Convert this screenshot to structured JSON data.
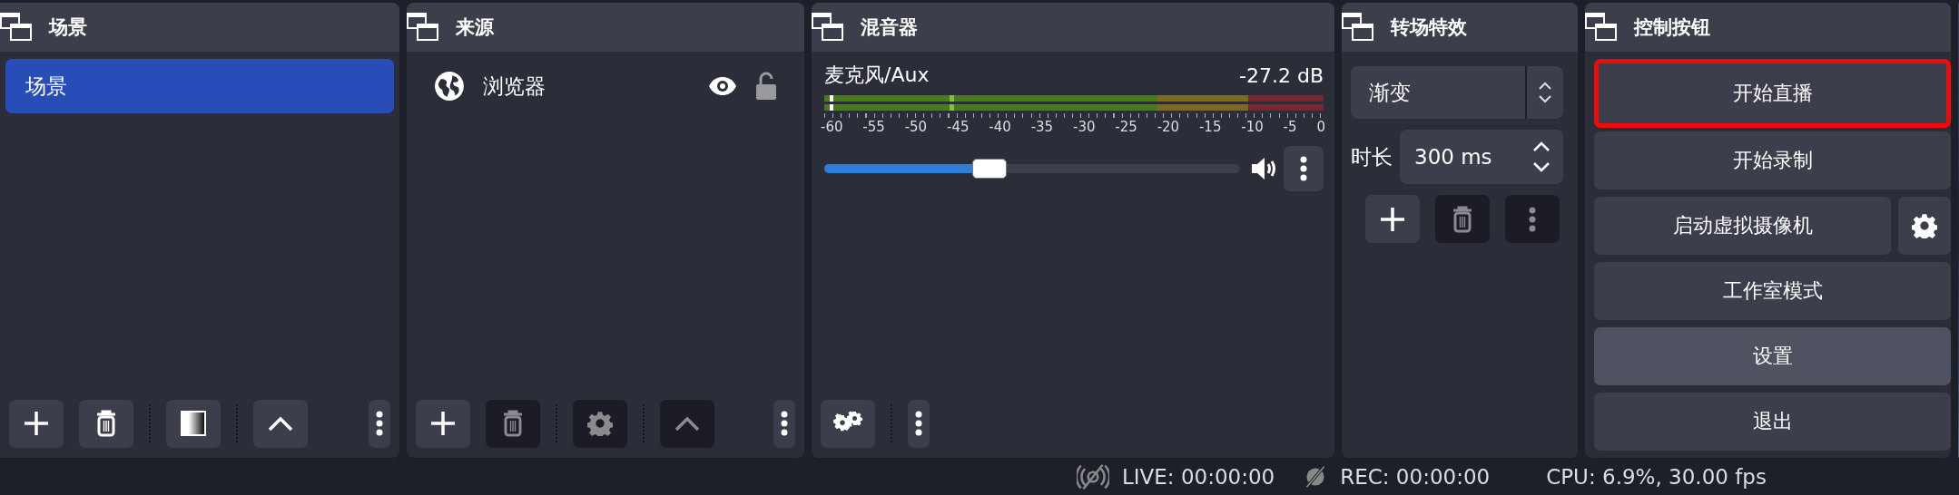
{
  "scenes": {
    "title": "场景",
    "items": [
      {
        "label": "场景",
        "selected": true
      }
    ],
    "toolbar": [
      {
        "kind": "add",
        "disabled": false
      },
      {
        "kind": "remove",
        "disabled": false
      },
      {
        "kind": "separator"
      },
      {
        "kind": "filters",
        "disabled": false
      },
      {
        "kind": "separator"
      },
      {
        "kind": "up",
        "disabled": false
      },
      {
        "kind": "spacer"
      },
      {
        "kind": "menu",
        "disabled": false
      }
    ]
  },
  "sources": {
    "title": "来源",
    "items": [
      {
        "label": "浏览器",
        "selected": false,
        "visible": true,
        "locked": false
      }
    ],
    "toolbar": [
      {
        "kind": "add",
        "disabled": false
      },
      {
        "kind": "remove",
        "disabled": true
      },
      {
        "kind": "separator"
      },
      {
        "kind": "properties",
        "disabled": true
      },
      {
        "kind": "separator"
      },
      {
        "kind": "up",
        "disabled": true
      },
      {
        "kind": "spacer"
      },
      {
        "kind": "menu",
        "disabled": false
      }
    ]
  },
  "mixer": {
    "title": "混音器",
    "channels": [
      {
        "name": "麦克风/Aux",
        "reading": "-27.2 dB",
        "level": 0.4,
        "muted": false,
        "ticks": [
          "-60",
          "-55",
          "-50",
          "-45",
          "-40",
          "-35",
          "-30",
          "-25",
          "-20",
          "-15",
          "-10",
          "-5",
          "0"
        ]
      }
    ],
    "toolbar": [
      {
        "kind": "advanced",
        "disabled": false
      },
      {
        "kind": "separator"
      },
      {
        "kind": "menu",
        "disabled": false
      }
    ]
  },
  "transitions": {
    "title": "转场特效",
    "transition": "渐变",
    "duration_label": "时长",
    "duration": "300 ms",
    "toolbar": [
      {
        "kind": "add",
        "disabled": false
      },
      {
        "kind": "remove",
        "disabled": true
      },
      {
        "kind": "menu",
        "disabled": true
      }
    ]
  },
  "controls": {
    "title": "控制按钮",
    "buttons": [
      {
        "label": "开始直播",
        "kind": "plain",
        "highlighted": true,
        "hovered": false
      },
      {
        "label": "开始录制",
        "kind": "plain",
        "highlighted": false,
        "hovered": false
      },
      {
        "label": "启动虚拟摄像机",
        "kind": "with-settings",
        "highlighted": false,
        "hovered": false
      },
      {
        "label": "工作室模式",
        "kind": "plain",
        "highlighted": false,
        "hovered": false
      },
      {
        "label": "设置",
        "kind": "plain",
        "highlighted": false,
        "hovered": true
      },
      {
        "label": "退出",
        "kind": "plain",
        "highlighted": false,
        "hovered": false
      }
    ]
  },
  "status_bar": {
    "live": "LIVE: 00:00:00",
    "rec": "REC: 00:00:00",
    "cpu": "CPU: 6.9%, 30.00 fps"
  }
}
